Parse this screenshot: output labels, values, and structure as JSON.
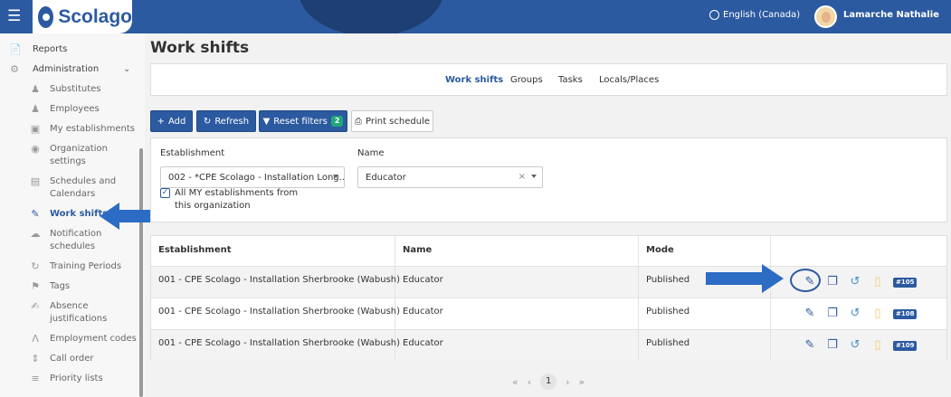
{
  "header": {
    "app_name": "Scolago",
    "language": "English (Canada)",
    "user_name": "Lamarche Nathalie"
  },
  "sidebar": {
    "items": [
      {
        "label": "Reports",
        "icon": "file-icon"
      },
      {
        "label": "Administration",
        "icon": "gear-icon"
      },
      {
        "label": "Substitutes",
        "icon": "person-icon"
      },
      {
        "label": "Employees",
        "icon": "people-icon"
      },
      {
        "label": "My establishments",
        "icon": "building-icon"
      },
      {
        "label": "Organization settings",
        "icon": "settings-icon"
      },
      {
        "label": "Schedules and Calendars",
        "icon": "calendar-icon"
      },
      {
        "label": "Work shifts",
        "icon": "work-shift-icon",
        "active": true
      },
      {
        "label": "Notification schedules",
        "icon": "notification-icon"
      },
      {
        "label": "Training Periods",
        "icon": "refresh-icon"
      },
      {
        "label": "Tags",
        "icon": "tag-icon"
      },
      {
        "label": "Absence justifications",
        "icon": "edit-icon"
      },
      {
        "label": "Employment codes",
        "icon": "code-icon"
      },
      {
        "label": "Call order",
        "icon": "sort-icon"
      },
      {
        "label": "Priority lists",
        "icon": "list-icon"
      }
    ]
  },
  "page": {
    "title": "Work shifts"
  },
  "tabs": [
    "Work shifts",
    "Groups",
    "Tasks",
    "Locals/Places"
  ],
  "toolbar": {
    "add": "Add",
    "refresh": "Refresh",
    "reset_filters": "Reset filters",
    "reset_count": "2",
    "print": "Print schedule"
  },
  "filters": {
    "establishment_label": "Establishment",
    "establishment_value": "002 - *CPE Scolago - Installation Long...",
    "name_label": "Name",
    "name_value": "Educator",
    "all_establishments_label": "All MY establishments from this organization",
    "all_establishments_checked": true
  },
  "table": {
    "columns": [
      "Establishment",
      "Name",
      "Mode"
    ],
    "rows": [
      {
        "establishment": "001 - CPE Scolago - Installation Sherbrooke (Wabush)",
        "name": "Educator",
        "mode": "Published",
        "id": "#105"
      },
      {
        "establishment": "001 - CPE Scolago - Installation Sherbrooke (Wabush)",
        "name": "Educator",
        "mode": "Published",
        "id": "#108"
      },
      {
        "establishment": "001 - CPE Scolago - Installation Sherbrooke (Wabush)",
        "name": "Educator",
        "mode": "Published",
        "id": "#109"
      }
    ]
  },
  "pagination": {
    "current_page": "1"
  },
  "colors": {
    "primary": "#2c5aa0",
    "badge_green": "#1fa87a"
  }
}
